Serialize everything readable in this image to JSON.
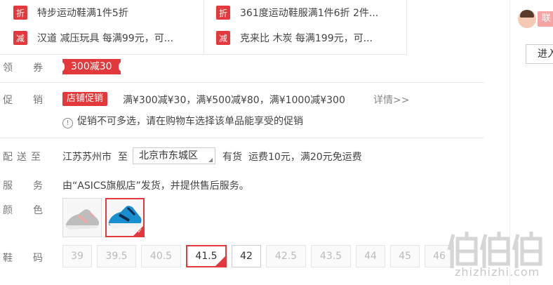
{
  "promotions": [
    {
      "tag": "折",
      "text": "特步运动鞋满1件5折"
    },
    {
      "tag": "折",
      "text": "361度运动鞋服满1件6折 2件..."
    },
    {
      "tag": "减",
      "text": "汉道 减压玩具 每满99元，可..."
    },
    {
      "tag": "减",
      "text": "克来比 木炭 每满199元，可..."
    }
  ],
  "coupon": {
    "label_1": "领",
    "label_2": "券",
    "value": "300减30"
  },
  "promo": {
    "label_1": "促",
    "label_2": "销",
    "badge": "店铺促销",
    "text": "满¥300减¥30，满¥500减¥80，满¥1000减¥300",
    "details": "详情>>",
    "notice_icon": "!",
    "notice": "促销不可多选，请在购物车选择该单品能享受的促销"
  },
  "delivery": {
    "label_1": "配",
    "label_2": "送",
    "label_3": "至",
    "origin": "江苏苏州市",
    "to": "至",
    "destination": "北京市东城区",
    "stock": "有货",
    "fee": "运费10元，满20元免运费"
  },
  "service": {
    "label_1": "服",
    "label_2": "务",
    "text": "由“ASICS旗舰店”发货，并提供售后服务。"
  },
  "color": {
    "label_1": "颜",
    "label_2": "色",
    "selected_index": 1
  },
  "size": {
    "label_1": "鞋",
    "label_2": "码",
    "options": [
      {
        "value": "39",
        "state": "disabled"
      },
      {
        "value": "39.5",
        "state": "disabled"
      },
      {
        "value": "40.5",
        "state": "disabled"
      },
      {
        "value": "41.5",
        "state": "selected"
      },
      {
        "value": "42",
        "state": "available"
      },
      {
        "value": "42.5",
        "state": "disabled"
      },
      {
        "value": "43.5",
        "state": "disabled"
      },
      {
        "value": "44",
        "state": "disabled"
      },
      {
        "value": "45",
        "state": "disabled"
      },
      {
        "value": "46",
        "state": "disabled"
      }
    ]
  },
  "sidebar": {
    "contact_label": "联",
    "enter_button": "进入"
  },
  "watermark": {
    "text": "zhizhizhi.com"
  },
  "colors": {
    "accent": "#e4393c",
    "text": "#333333",
    "muted": "#777777"
  }
}
